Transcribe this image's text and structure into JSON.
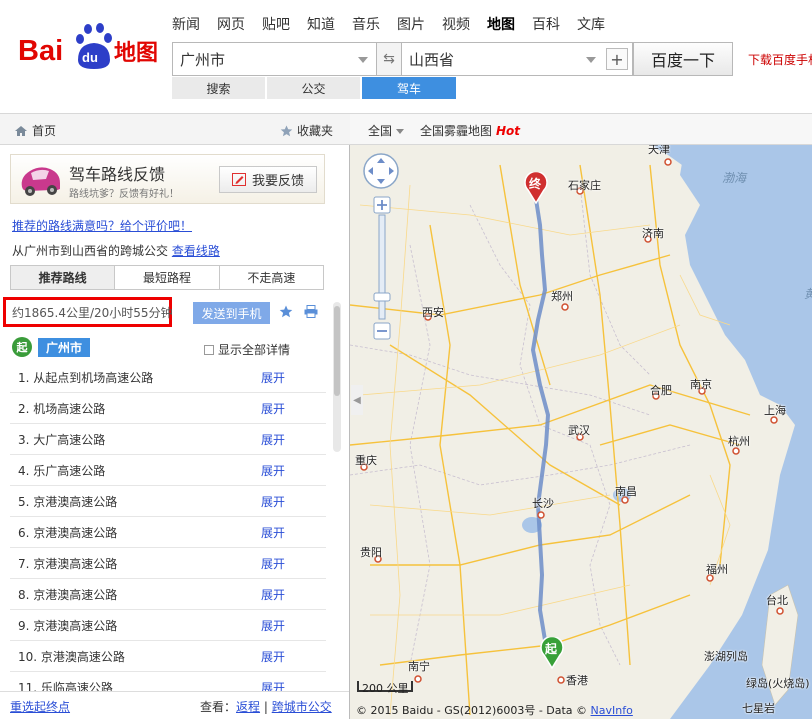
{
  "header": {
    "logo_text": "Bai du 地图",
    "nav": [
      "新闻",
      "网页",
      "贴吧",
      "知道",
      "音乐",
      "图片",
      "视频",
      "地图",
      "百科",
      "文库"
    ],
    "active_nav": "地图",
    "from": "广州市",
    "to": "山西省",
    "go": "百度一下",
    "download": "下载百度手机",
    "mode_tabs": [
      "搜索",
      "公交",
      "驾车"
    ],
    "active_mode": "驾车"
  },
  "toolbar": {
    "home": "首页",
    "fav": "收藏夹",
    "nation": "全国",
    "smog": "全国雾霾地图",
    "hot": "Hot"
  },
  "left": {
    "feedback_title": "驾车路线反馈",
    "feedback_sub": "路线坑爹？反馈有好礼！",
    "feedback_btn": "我要反馈",
    "rate_link": "推荐的路线满意吗？给个评价吧！",
    "cross_text": "从广州市到山西省的跨城公交",
    "cross_link": "查看线路",
    "route_tabs": [
      "推荐路线",
      "最短路程",
      "不走高速"
    ],
    "active_route": "推荐路线",
    "summary": "约1865.4公里/20小时55分钟",
    "send": "发送到手机",
    "start_badge": "起",
    "start_city": "广州市",
    "show_all": "显示全部详情",
    "steps": [
      {
        "text": "1.  从起点到机场高速公路",
        "expand": "展开"
      },
      {
        "text": "2.  机场高速公路",
        "expand": "展开"
      },
      {
        "text": "3.  大广高速公路",
        "expand": "展开"
      },
      {
        "text": "4.  乐广高速公路",
        "expand": "展开"
      },
      {
        "text": "5.  京港澳高速公路",
        "expand": "展开"
      },
      {
        "text": "6.  京港澳高速公路",
        "expand": "展开"
      },
      {
        "text": "7.  京港澳高速公路",
        "expand": "展开"
      },
      {
        "text": "8.  京港澳高速公路",
        "expand": "展开"
      },
      {
        "text": "9.  京港澳高速公路",
        "expand": "展开"
      },
      {
        "text": "10. 京港澳高速公路",
        "expand": "展开"
      },
      {
        "text": "11. 乐临高速公路",
        "expand": "展开"
      }
    ],
    "reset": "重选起终点",
    "look_label": "查看：",
    "back": "返程",
    "city_bus": "跨城市公交"
  },
  "map": {
    "scale": "200 公里",
    "copyright": "© 2015 Baidu - GS(2012)6003号 - Data © ",
    "navinfo": "NavInfo",
    "end_badge": "终",
    "start_badge": "起",
    "cities": [
      {
        "name": "天津"
      },
      {
        "name": "石家庄"
      },
      {
        "name": "济南"
      },
      {
        "name": "郑州"
      },
      {
        "name": "西安"
      },
      {
        "name": "合肥"
      },
      {
        "name": "南京"
      },
      {
        "name": "上海"
      },
      {
        "name": "武汉"
      },
      {
        "name": "杭州"
      },
      {
        "name": "重庆"
      },
      {
        "name": "长沙"
      },
      {
        "name": "南昌"
      },
      {
        "name": "贵阳"
      },
      {
        "name": "福州"
      },
      {
        "name": "台北"
      },
      {
        "name": "南宁"
      },
      {
        "name": "香港"
      },
      {
        "name": "澎湖列岛"
      },
      {
        "name": "绿岛(火烧岛)"
      },
      {
        "name": "七星岩"
      }
    ],
    "seas": [
      "渤海",
      "黄"
    ],
    "colors": {
      "water": "#aac6e8",
      "land": "#f1efe6",
      "highway": "#f6c23c",
      "route": "#6d8dc8"
    }
  }
}
